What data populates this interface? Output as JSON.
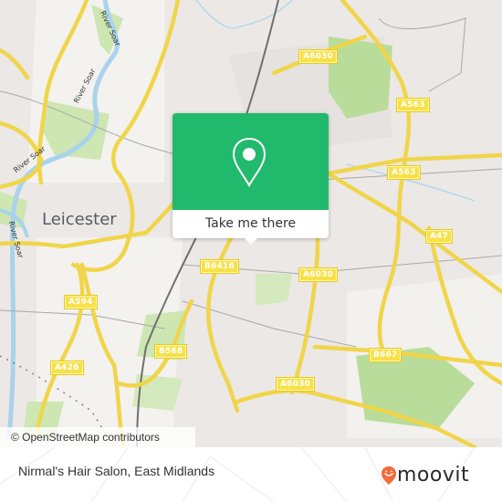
{
  "map": {
    "city_label": "Leicester",
    "river_labels": [
      "River Soar",
      "River Soar",
      "River Soar",
      "River Soar"
    ],
    "road_labels": [
      "A6030",
      "A563",
      "A563",
      "A47",
      "B6416",
      "A6030",
      "A594",
      "B568",
      "B667",
      "A6030",
      "A426"
    ],
    "attribution": "© OpenStreetMap contributors",
    "colors": {
      "land": "#ece8e6",
      "park": "#cde6b2",
      "water": "#a9d3ec",
      "major_road": "#f7e14a",
      "rail": "#777777"
    }
  },
  "popup": {
    "button_label": "Take me there",
    "icon": "location-pin-icon",
    "accent_color": "#21ba6c"
  },
  "footer": {
    "place_name": "Nirmal's Hair Salon, East Midlands",
    "logo_text": "moovit",
    "logo_icon": "moovit-smile-pin-icon",
    "logo_color": "#f26b3a"
  }
}
